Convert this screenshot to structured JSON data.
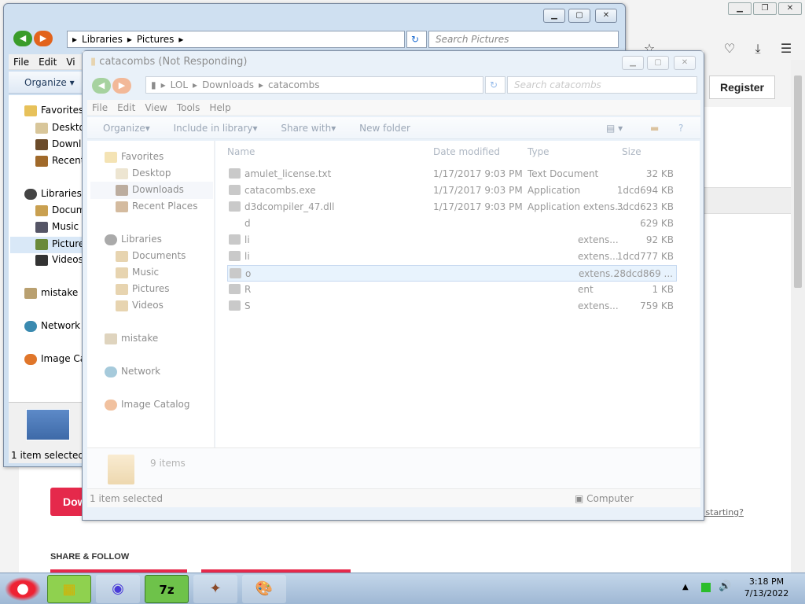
{
  "browser": {
    "register_label": "Register",
    "download_label": "Dow",
    "not_starting_link": "not starting?",
    "share_heading": "SHARE & FOLLOW",
    "min_icon": "minimize-icon",
    "max_icon": "restore-icon",
    "close_icon": "close-icon"
  },
  "window_back": {
    "breadcrumb": [
      "Libraries",
      "Pictures"
    ],
    "search_placeholder": "Search Pictures",
    "menu": [
      "File",
      "Edit",
      "Vi"
    ],
    "organize": "Organize",
    "favorites_label": "Favorites",
    "nav": [
      "Desktop",
      "Downlo",
      "Recent P",
      "Libraries",
      "Docume",
      "Music",
      "Pictures",
      "Videos",
      "mistake",
      "Network",
      "Image Cat"
    ],
    "status": "1 item selected"
  },
  "window_front": {
    "title": "catacombs (Not Responding)",
    "breadcrumb": [
      "LOL",
      "Downloads",
      "catacombs"
    ],
    "search_placeholder": "Search catacombs",
    "menu": [
      "File",
      "Edit",
      "View",
      "Tools",
      "Help"
    ],
    "commands": [
      "Organize",
      "Include in library",
      "Share with",
      "New folder"
    ],
    "nav": {
      "favorites": "Favorites",
      "desktop": "Desktop",
      "downloads": "Downloads",
      "recent": "Recent Places",
      "libraries": "Libraries",
      "documents": "Documents",
      "music": "Music",
      "pictures": "Pictures",
      "videos": "Videos",
      "mistake": "mistake",
      "network": "Network",
      "image_catalog": "Image Catalog"
    },
    "columns": [
      "Name",
      "Date modified",
      "Type",
      "Size"
    ],
    "files": [
      {
        "name": "amulet_license.txt",
        "date": "1/17/2017 9:03 PM",
        "type": "Text Document",
        "size": "32 KB"
      },
      {
        "name": "catacombs.exe",
        "date": "1/17/2017 9:03 PM",
        "type": "Application",
        "size": "1dcd694 KB"
      },
      {
        "name": "d3dcompiler_47.dll",
        "date": "1/17/2017 9:03 PM",
        "type": "Application extens...",
        "size": "3dcd623 KB"
      },
      {
        "name": "d",
        "date": "",
        "type": "",
        "size": "629 KB"
      },
      {
        "name": "li",
        "date": "",
        "type": "extens...",
        "size": "92 KB"
      },
      {
        "name": "li",
        "date": "",
        "type": "extens...",
        "size": "1dcd777 KB"
      },
      {
        "name": "o",
        "date": "",
        "type": "extens...",
        "size": "28dcd869 ..."
      },
      {
        "name": "R",
        "date": "",
        "type": "ent",
        "size": "1 KB"
      },
      {
        "name": "S",
        "date": "",
        "type": "extens...",
        "size": "759 KB"
      }
    ],
    "item_count": "9 items",
    "status": "1 item selected",
    "computer_label": "Computer"
  },
  "taskbar": {
    "time": "3:18 PM",
    "date": "7/13/2022"
  }
}
